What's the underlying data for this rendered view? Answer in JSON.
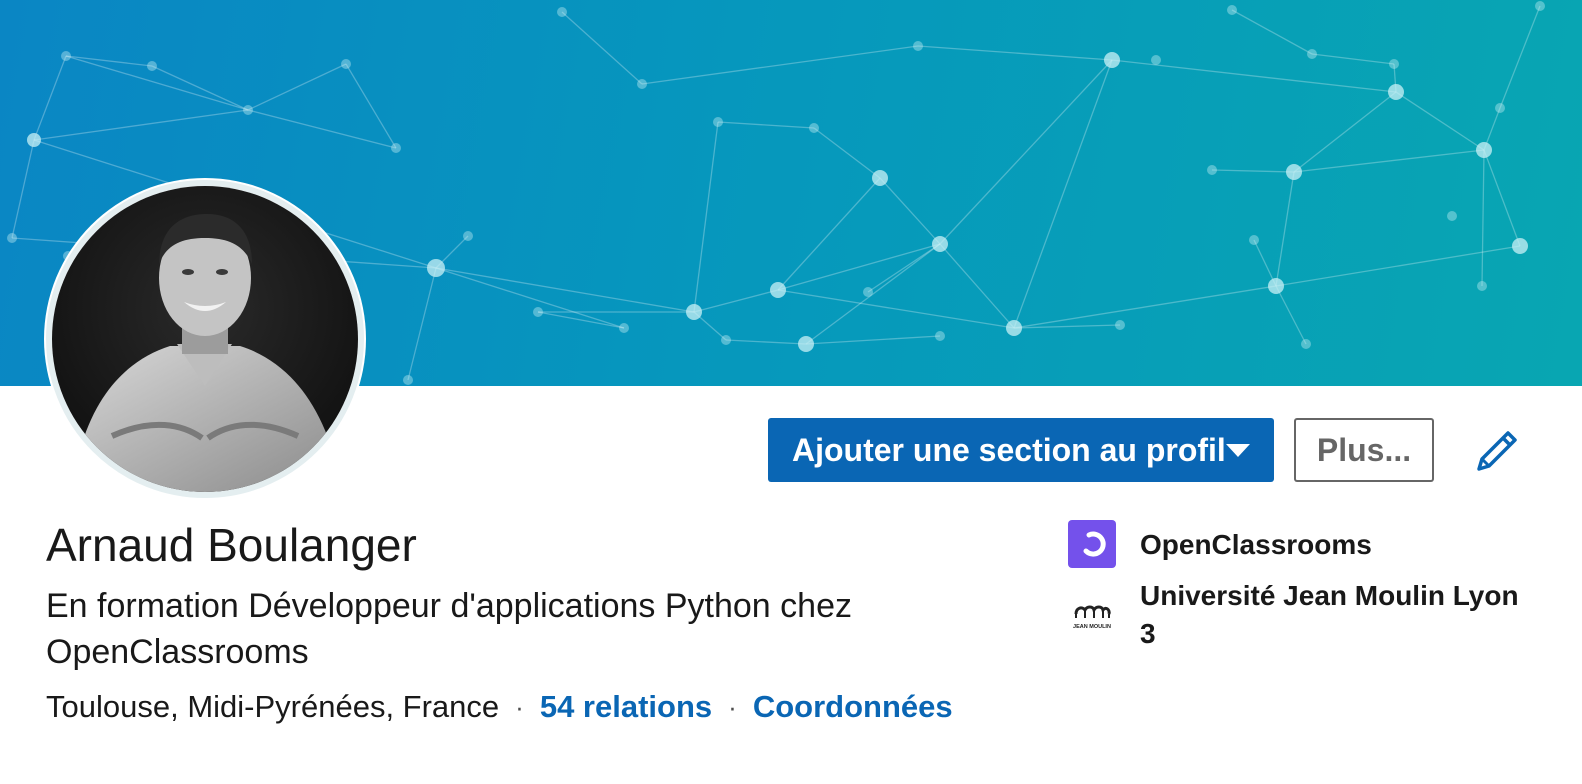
{
  "profile": {
    "name": "Arnaud Boulanger",
    "headline": "En formation Développeur d'applications Python chez OpenClassrooms",
    "location": "Toulouse, Midi-Pyrénées, France",
    "separator": "·",
    "connections_link": "54 relations",
    "contact_link": "Coordonnées"
  },
  "actions": {
    "add_section_label": "Ajouter une section au profil",
    "more_label": "Plus..."
  },
  "organizations": [
    {
      "name": "OpenClassrooms",
      "logo_icon": "openclassrooms-logo",
      "logo_color": "#7451eb"
    },
    {
      "name": "Université Jean Moulin Lyon 3",
      "logo_icon": "jean-moulin-logo",
      "logo_text": "JEAN MOULIN"
    }
  ],
  "colors": {
    "primary": "#0a66b4",
    "banner_start": "#0a86c4",
    "banner_end": "#08a6b2"
  }
}
